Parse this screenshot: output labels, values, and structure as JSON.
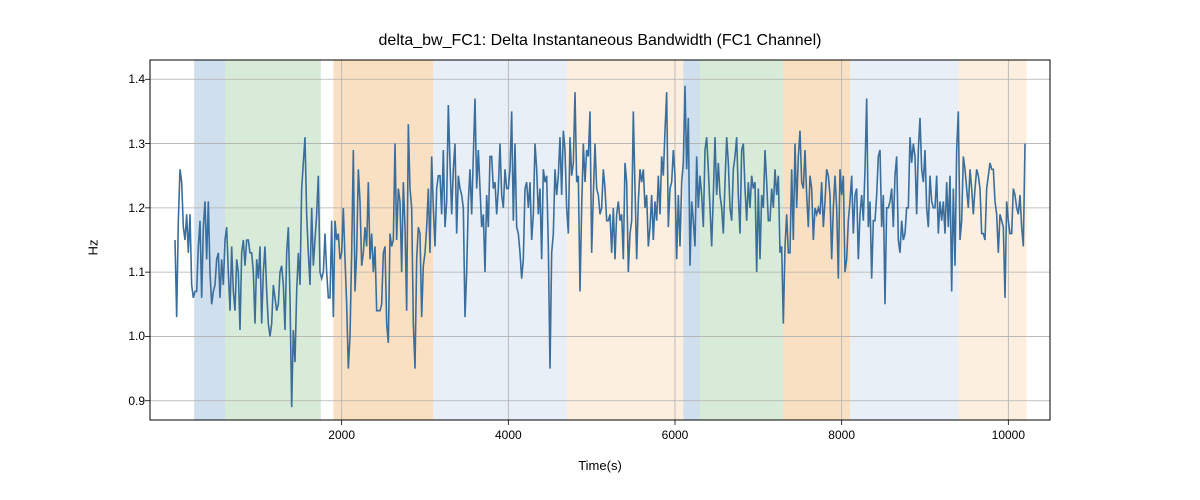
{
  "chart_data": {
    "type": "line",
    "title": "delta_bw_FC1: Delta Instantaneous Bandwidth (FC1 Channel)",
    "xlabel": "Time(s)",
    "ylabel": "Hz",
    "xlim": [
      -300,
      10500
    ],
    "ylim": [
      0.87,
      1.43
    ],
    "x_ticks": [
      2000,
      4000,
      6000,
      8000,
      10000
    ],
    "y_ticks": [
      0.9,
      1.0,
      1.1,
      1.2,
      1.3,
      1.4
    ],
    "regions": [
      {
        "start": 230,
        "end": 600,
        "color": "#a8c5df",
        "alpha": 0.55
      },
      {
        "start": 600,
        "end": 1750,
        "color": "#b8dbb8",
        "alpha": 0.55
      },
      {
        "start": 1900,
        "end": 3100,
        "color": "#f5c690",
        "alpha": 0.55
      },
      {
        "start": 3100,
        "end": 4700,
        "color": "#d5e2ee",
        "alpha": 0.55
      },
      {
        "start": 4700,
        "end": 6100,
        "color": "#f9e2c6",
        "alpha": 0.55
      },
      {
        "start": 6100,
        "end": 6300,
        "color": "#a8c5df",
        "alpha": 0.55
      },
      {
        "start": 6300,
        "end": 7300,
        "color": "#b8dbb8",
        "alpha": 0.55
      },
      {
        "start": 7300,
        "end": 8100,
        "color": "#f5c690",
        "alpha": 0.55
      },
      {
        "start": 8100,
        "end": 9400,
        "color": "#d5e2ee",
        "alpha": 0.55
      },
      {
        "start": 9400,
        "end": 10220,
        "color": "#f9e2c6",
        "alpha": 0.55
      }
    ],
    "series": [
      {
        "name": "delta_bw_FC1",
        "color": "#3b6e9b",
        "x_start": 0,
        "x_step": 20,
        "values": [
          1.15,
          1.03,
          1.18,
          1.26,
          1.24,
          1.17,
          1.15,
          1.19,
          1.13,
          1.19,
          1.08,
          1.06,
          1.07,
          1.07,
          1.14,
          1.18,
          1.06,
          1.17,
          1.21,
          1.12,
          1.21,
          1.1,
          1.05,
          1.07,
          1.08,
          1.12,
          1.13,
          1.06,
          1.12,
          1.08,
          1.15,
          1.17,
          1.1,
          1.04,
          1.14,
          1.07,
          1.04,
          1.12,
          1.1,
          1.01,
          1.13,
          1.15,
          1.11,
          1.15,
          1.15,
          1.13,
          1.13,
          1.1,
          1.02,
          1.12,
          1.09,
          1.14,
          1.02,
          1.1,
          1.14,
          1.07,
          1.02,
          1.0,
          1.02,
          1.08,
          1.06,
          1.04,
          1.05,
          1.1,
          1.11,
          1.08,
          1.01,
          1.13,
          1.17,
          1.06,
          0.89,
          1.01,
          0.96,
          1.07,
          1.13,
          1.08,
          1.23,
          1.27,
          1.31,
          1.19,
          1.13,
          1.08,
          1.2,
          1.11,
          1.15,
          1.19,
          1.25,
          1.1,
          1.09,
          1.1,
          1.16,
          1.1,
          1.06,
          1.06,
          1.18,
          1.03,
          1.18,
          1.15,
          1.16,
          1.12,
          1.13,
          1.2,
          1.12,
          1.05,
          0.95,
          1.0,
          1.13,
          1.29,
          1.07,
          1.13,
          1.26,
          1.21,
          1.11,
          1.13,
          1.17,
          1.14,
          1.24,
          1.12,
          1.16,
          1.1,
          1.14,
          1.04,
          1.04,
          1.04,
          1.05,
          1.13,
          1.14,
          1.02,
          0.99,
          1.16,
          1.14,
          1.15,
          1.3,
          1.15,
          1.23,
          1.21,
          1.1,
          1.24,
          1.17,
          1.04,
          1.33,
          1.23,
          1.2,
          1.02,
          0.95,
          1.12,
          1.17,
          1.16,
          1.03,
          1.11,
          1.13,
          1.17,
          1.23,
          1.13,
          1.28,
          1.2,
          1.14,
          1.23,
          1.25,
          1.25,
          1.19,
          1.29,
          1.17,
          1.21,
          1.36,
          1.27,
          1.19,
          1.26,
          1.3,
          1.16,
          1.25,
          1.23,
          1.22,
          1.2,
          1.03,
          1.1,
          1.21,
          1.26,
          1.19,
          1.28,
          1.37,
          1.23,
          1.29,
          1.23,
          1.17,
          1.19,
          1.1,
          1.22,
          1.17,
          1.28,
          1.28,
          1.23,
          1.24,
          1.19,
          1.23,
          1.3,
          1.22,
          1.2,
          1.26,
          1.23,
          1.23,
          1.26,
          1.35,
          1.18,
          1.3,
          1.17,
          1.16,
          1.13,
          1.09,
          1.12,
          1.23,
          1.24,
          1.2,
          1.24,
          1.15,
          1.19,
          1.3,
          1.26,
          1.19,
          1.23,
          1.12,
          1.26,
          1.24,
          1.25,
          1.14,
          0.95,
          1.13,
          1.16,
          1.26,
          1.22,
          1.25,
          1.31,
          1.22,
          1.32,
          1.29,
          1.2,
          1.16,
          1.31,
          1.25,
          1.27,
          1.38,
          1.24,
          1.25,
          1.07,
          1.2,
          1.3,
          1.24,
          1.29,
          1.28,
          1.35,
          1.13,
          1.22,
          1.3,
          1.23,
          1.22,
          1.19,
          1.2,
          1.26,
          1.23,
          1.18,
          1.18,
          1.19,
          1.13,
          1.2,
          1.12,
          1.19,
          1.21,
          1.18,
          1.19,
          1.12,
          1.27,
          1.24,
          1.1,
          1.16,
          1.18,
          1.35,
          1.23,
          1.12,
          1.21,
          1.26,
          1.24,
          1.26,
          1.2,
          1.22,
          1.14,
          1.17,
          1.22,
          1.15,
          1.21,
          1.18,
          1.25,
          1.19,
          1.28,
          1.25,
          1.32,
          1.38,
          1.17,
          1.23,
          1.24,
          1.29,
          1.25,
          1.12,
          1.22,
          1.14,
          1.24,
          1.27,
          1.39,
          1.26,
          1.34,
          1.11,
          1.21,
          1.18,
          1.14,
          1.28,
          1.2,
          1.25,
          1.22,
          1.17,
          1.29,
          1.31,
          1.26,
          1.2,
          1.14,
          1.22,
          1.31,
          1.22,
          1.27,
          1.22,
          1.2,
          1.16,
          1.24,
          1.31,
          1.27,
          1.2,
          1.18,
          1.26,
          1.28,
          1.31,
          1.22,
          1.16,
          1.29,
          1.3,
          1.23,
          1.18,
          1.24,
          1.2,
          1.25,
          1.23,
          1.24,
          1.1,
          1.23,
          1.12,
          1.22,
          1.2,
          1.29,
          1.24,
          1.18,
          1.18,
          1.23,
          1.2,
          1.26,
          1.22,
          1.25,
          1.13,
          1.14,
          1.02,
          1.14,
          1.19,
          1.13,
          1.13,
          1.26,
          1.15,
          1.3,
          1.2,
          1.28,
          1.32,
          1.24,
          1.23,
          1.29,
          1.22,
          1.17,
          1.25,
          1.23,
          1.15,
          1.2,
          1.19,
          1.2,
          1.19,
          1.24,
          1.17,
          1.21,
          1.26,
          1.25,
          1.22,
          1.12,
          1.2,
          1.25,
          1.2,
          1.09,
          1.26,
          1.22,
          1.25,
          1.1,
          1.12,
          1.18,
          1.21,
          1.25,
          1.16,
          1.22,
          1.23,
          1.12,
          1.19,
          1.22,
          1.18,
          1.26,
          1.37,
          1.17,
          1.21,
          1.09,
          1.18,
          1.18,
          1.22,
          1.28,
          1.29,
          1.17,
          1.22,
          1.05,
          1.2,
          1.2,
          1.21,
          1.23,
          1.17,
          1.25,
          1.28,
          1.15,
          1.13,
          1.18,
          1.15,
          1.16,
          1.2,
          1.2,
          1.31,
          1.27,
          1.3,
          1.28,
          1.19,
          1.29,
          1.34,
          1.26,
          1.24,
          1.29,
          1.2,
          1.17,
          1.25,
          1.21,
          1.2,
          1.2,
          1.25,
          1.16,
          1.21,
          1.18,
          1.21,
          1.16,
          1.24,
          1.17,
          1.25,
          1.07,
          1.23,
          1.11,
          1.29,
          1.35,
          1.15,
          1.18,
          1.28,
          1.26,
          1.23,
          1.2,
          1.26,
          1.23,
          1.19,
          1.23,
          1.26,
          1.25,
          1.23,
          1.16,
          1.16,
          1.15,
          1.23,
          1.25,
          1.27,
          1.26,
          1.26,
          1.21,
          1.19,
          1.13,
          1.19,
          1.18,
          1.17,
          1.06,
          1.21,
          1.18,
          1.16,
          1.16,
          1.23,
          1.22,
          1.2,
          1.19,
          1.22,
          1.17,
          1.14,
          1.3
        ]
      }
    ]
  }
}
